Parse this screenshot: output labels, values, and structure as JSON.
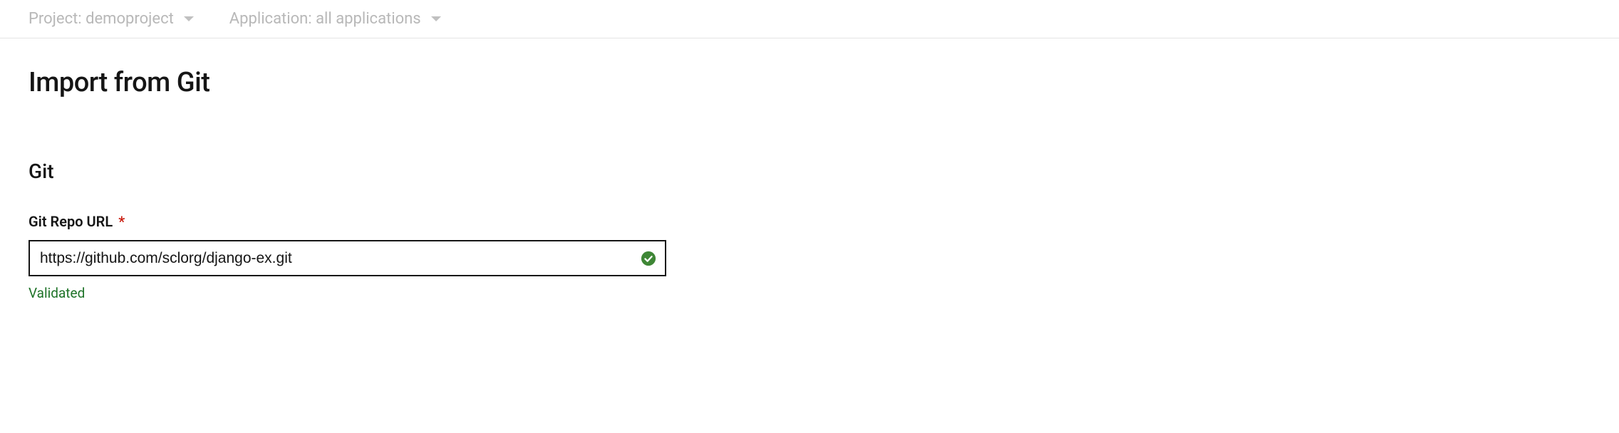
{
  "topbar": {
    "project_label": "Project: demoproject",
    "application_label": "Application: all applications"
  },
  "page": {
    "title": "Import from Git"
  },
  "git_section": {
    "heading": "Git",
    "repo_url_label": "Git Repo URL",
    "required_marker": "*",
    "repo_url_value": "https://github.com/sclorg/django-ex.git",
    "validation_status": "Validated"
  }
}
